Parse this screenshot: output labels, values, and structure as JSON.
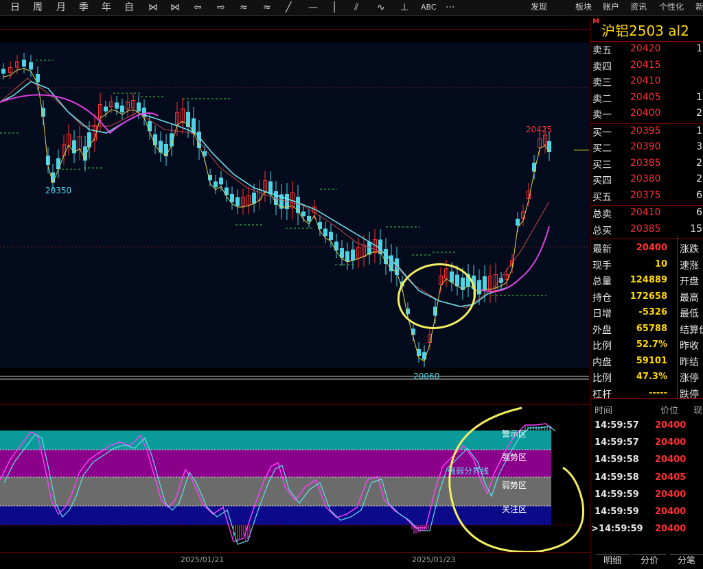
{
  "toolbar": {
    "items": [
      "日",
      "周",
      "月",
      "季",
      "年",
      "自",
      "⋈",
      "⋈",
      "⇦",
      "⇨",
      "≈",
      "≈",
      "╱",
      "—",
      "│",
      "⫽",
      "∿",
      "⊥",
      "ABC",
      "···"
    ],
    "right": [
      "发现",
      "板块",
      "账户",
      "资讯",
      "个性化",
      "新"
    ]
  },
  "main_chart": {
    "high_label": "20425",
    "low_label": "20060",
    "left_low_label": "20350"
  },
  "indicator": {
    "zones": [
      "警示区",
      "强势区",
      "弱势区",
      "关注区"
    ],
    "divider_label": "强弱分界线"
  },
  "xaxis": {
    "dates": [
      "2025/01/21",
      "2025/01/23"
    ]
  },
  "symbol": {
    "flag": "M",
    "title": "沪铝2503  al2"
  },
  "orderbook": {
    "asks": [
      {
        "label": "卖五",
        "price": "20420",
        "vol": "1"
      },
      {
        "label": "卖四",
        "price": "20415",
        "vol": ""
      },
      {
        "label": "卖三",
        "price": "20410",
        "vol": ""
      },
      {
        "label": "卖二",
        "price": "20405",
        "vol": "1"
      },
      {
        "label": "卖一",
        "price": "20400",
        "vol": "2"
      }
    ],
    "bids": [
      {
        "label": "买一",
        "price": "20395",
        "vol": "1"
      },
      {
        "label": "买二",
        "price": "20390",
        "vol": "3"
      },
      {
        "label": "买三",
        "price": "20385",
        "vol": "2"
      },
      {
        "label": "买四",
        "price": "20380",
        "vol": "2"
      },
      {
        "label": "买五",
        "price": "20375",
        "vol": "6"
      }
    ],
    "totals": [
      {
        "label": "总卖",
        "price": "20410",
        "vol": "6"
      },
      {
        "label": "总买",
        "price": "20385",
        "vol": "15"
      }
    ]
  },
  "quote": [
    {
      "label": "最新",
      "value": "20400",
      "color": "red",
      "label2": "涨跌"
    },
    {
      "label": "现手",
      "value": "10",
      "color": "yellow",
      "label2": "速涨"
    },
    {
      "label": "总量",
      "value": "124889",
      "color": "yellow",
      "label2": "开盘"
    },
    {
      "label": "持仓",
      "value": "172658",
      "color": "yellow",
      "label2": "最高"
    },
    {
      "label": "日增",
      "value": "-5326",
      "color": "yellow",
      "label2": "最低"
    },
    {
      "label": "外盘",
      "value": "65788",
      "color": "yellow",
      "label2": "结算价"
    },
    {
      "label": "比例",
      "value": "52.7%",
      "color": "yellow",
      "label2": "昨收"
    },
    {
      "label": "内盘",
      "value": "59101",
      "color": "yellow",
      "label2": "昨结"
    },
    {
      "label": "比例",
      "value": "47.3%",
      "color": "yellow",
      "label2": "涨停"
    },
    {
      "label": "杠杆",
      "value": "-----",
      "color": "yellow",
      "label2": "跌停"
    }
  ],
  "ticks": {
    "headers": [
      "时间",
      "价位",
      "现"
    ],
    "rows": [
      {
        "time": "14:59:57",
        "price": "20400"
      },
      {
        "time": "14:59:57",
        "price": "20400"
      },
      {
        "time": "14:59:58",
        "price": "20400"
      },
      {
        "time": "14:59:58",
        "price": "20405"
      },
      {
        "time": "14:59:59",
        "price": "20400"
      },
      {
        "time": "14:59:59",
        "price": "20400"
      },
      {
        "time": ">14:59:59",
        "price": "20400"
      }
    ]
  },
  "tabs": [
    "明细",
    "分价",
    "分笔"
  ]
}
